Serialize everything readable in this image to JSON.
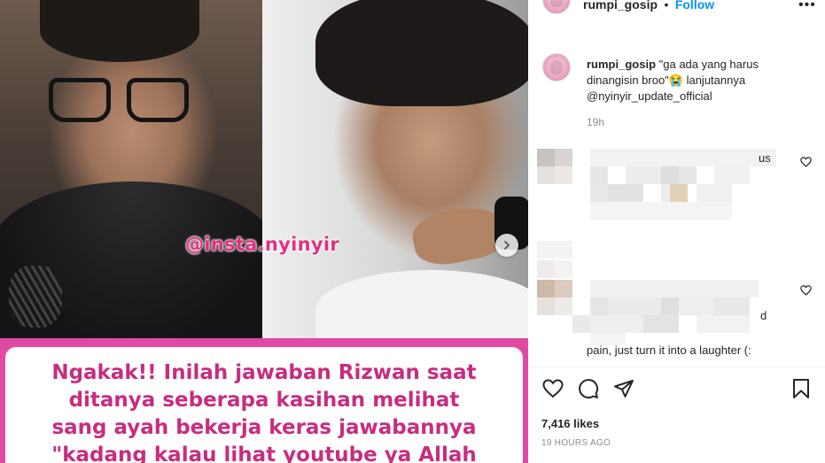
{
  "post": {
    "watermark": "@insta.nyinyir",
    "caption_lines": [
      "Ngakak!! Inilah jawaban Rizwan saat",
      "ditanya seberapa kasihan melihat",
      "sang ayah bekerja keras jawabannya",
      "\"kadang kalau lihat youtube ya Allah"
    ],
    "next_icon": "chevron-right-icon"
  },
  "header": {
    "username": "rumpi_gosip",
    "separator": "•",
    "follow_label": "Follow",
    "more_icon": "more-icon"
  },
  "caption": {
    "username": "rumpi_gosip",
    "text": "\"ga ada yang harus dinangisin broo\"😭 lanjutannya @nyinyir_update_official",
    "time": "19h"
  },
  "comments": [
    {
      "visible_text": "us",
      "like_icon": "heart-icon"
    },
    {
      "visible_text": "d",
      "visible_text_2": "pain, just turn it into a laughter (:",
      "like_icon": "heart-icon"
    }
  ],
  "actions": {
    "like_icon": "heart-icon",
    "comment_icon": "comment-icon",
    "share_icon": "share-icon",
    "save_icon": "bookmark-icon"
  },
  "likes": "7,416 likes",
  "date": "19 HOURS AGO",
  "colors": {
    "accent": "#0095f6",
    "caption_frame": "#e04aa3",
    "caption_text": "#c72d7f",
    "watermark": "#e2317f"
  }
}
